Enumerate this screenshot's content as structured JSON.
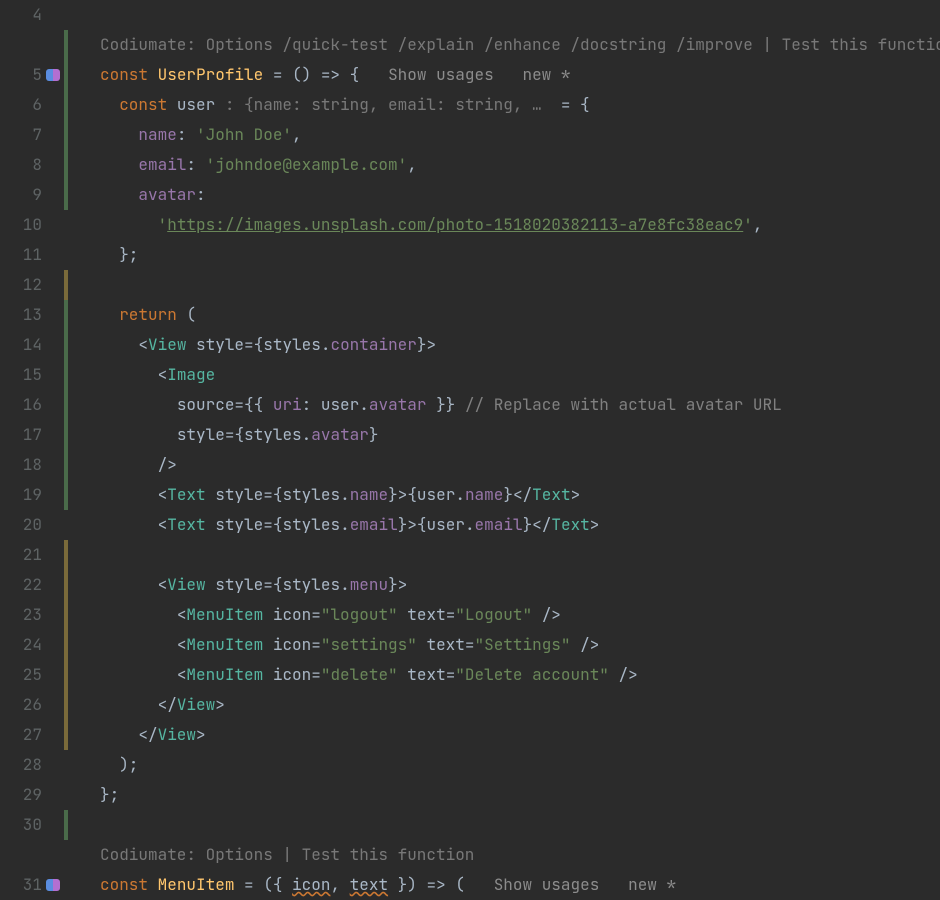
{
  "lineNumbers": [
    "4",
    "5",
    "6",
    "7",
    "8",
    "9",
    "10",
    "11",
    "12",
    "13",
    "14",
    "15",
    "16",
    "17",
    "18",
    "19",
    "20",
    "21",
    "22",
    "23",
    "24",
    "25",
    "26",
    "27",
    "28",
    "29",
    "30",
    "31"
  ],
  "iconLines": [
    1,
    27
  ],
  "bars": [
    {
      "from": 1,
      "to": 7,
      "cls": ""
    },
    {
      "from": 9,
      "to": 10,
      "cls": "yellow"
    },
    {
      "from": 10,
      "to": 17,
      "cls": ""
    },
    {
      "from": 18,
      "to": 25,
      "cls": "yellow"
    },
    {
      "from": 27,
      "to": 28,
      "cls": ""
    }
  ],
  "codiumate1": "Codiumate: Options /quick-test /explain /enhance /docstring /improve | Test this function",
  "l5": {
    "const": "const",
    "name": "UserProfile",
    "rest": " = () => {",
    "usages": "Show usages",
    "new": "new *"
  },
  "l6": {
    "const": "const",
    "name": "user",
    "hint": " : {name: string, email: string, … ",
    "rest": " = {"
  },
  "l7": {
    "prop": "name",
    "sep": ": ",
    "str": "'John Doe'",
    "end": ","
  },
  "l8": {
    "prop": "email",
    "sep": ": ",
    "str": "'johndoe@example.com'",
    "end": ","
  },
  "l9": {
    "prop": "avatar",
    "sep": ":"
  },
  "l10": {
    "q1": "'",
    "url": "https://images.unsplash.com/photo-1518020382113-a7e8fc38eac9",
    "q2": "'",
    "end": ","
  },
  "l11": {
    "end": "};"
  },
  "l13": {
    "ret": "return",
    "paren": " ("
  },
  "l14": {
    "open": "<",
    "tag": "View",
    "sp": " ",
    "attr": "style",
    "eq": "=",
    "lb": "{",
    "obj": "styles",
    "dot": ".",
    "p": "container",
    "rb": "}",
    "close": ">"
  },
  "l15": {
    "open": "<",
    "tag": "Image"
  },
  "l16": {
    "attr": "source",
    "eq": "=",
    "lb": "{{ ",
    "uri": "uri",
    "c": ": ",
    "obj": "user",
    "dot": ".",
    "p": "avatar",
    "rb": " }}",
    "cmt": " // Replace with actual avatar URL"
  },
  "l17": {
    "attr": "style",
    "eq": "=",
    "lb": "{",
    "obj": "styles",
    "dot": ".",
    "p": "avatar",
    "rb": "}"
  },
  "l18": {
    "close": "/>"
  },
  "l19": {
    "open": "<",
    "tag": "Text",
    "sp": " ",
    "attr": "style",
    "eq": "=",
    "lb": "{",
    "obj": "styles",
    "dot": ".",
    "p": "name",
    "rb": "}",
    "gt": ">",
    "elb": "{",
    "eo": "user",
    "ed": ".",
    "ep": "name",
    "erb": "}",
    "co": "</",
    "ct": "Text",
    "cg": ">"
  },
  "l20": {
    "open": "<",
    "tag": "Text",
    "sp": " ",
    "attr": "style",
    "eq": "=",
    "lb": "{",
    "obj": "styles",
    "dot": ".",
    "p": "email",
    "rb": "}",
    "gt": ">",
    "elb": "{",
    "eo": "user",
    "ed": ".",
    "ep": "email",
    "erb": "}",
    "co": "</",
    "ct": "Text",
    "cg": ">"
  },
  "l22": {
    "open": "<",
    "tag": "View",
    "sp": " ",
    "attr": "style",
    "eq": "=",
    "lb": "{",
    "obj": "styles",
    "dot": ".",
    "p": "menu",
    "rb": "}",
    "close": ">"
  },
  "l23": {
    "open": "<",
    "tag": "MenuItem",
    "sp": " ",
    "a1": "icon",
    "eq1": "=",
    "s1": "\"logout\"",
    "sp2": " ",
    "a2": "text",
    "eq2": "=",
    "s2": "\"Logout\"",
    "end": " />"
  },
  "l24": {
    "open": "<",
    "tag": "MenuItem",
    "sp": " ",
    "a1": "icon",
    "eq1": "=",
    "s1": "\"settings\"",
    "sp2": " ",
    "a2": "text",
    "eq2": "=",
    "s2": "\"Settings\"",
    "end": " />"
  },
  "l25": {
    "open": "<",
    "tag": "MenuItem",
    "sp": " ",
    "a1": "icon",
    "eq1": "=",
    "s1": "\"delete\"",
    "sp2": " ",
    "a2": "text",
    "eq2": "=",
    "s2": "\"Delete account\"",
    "end": " />"
  },
  "l26": {
    "co": "</",
    "tag": "View",
    "cg": ">"
  },
  "l27": {
    "co": "</",
    "tag": "View",
    "cg": ">"
  },
  "l28": {
    "end": ");"
  },
  "l29": {
    "end": "};"
  },
  "codiumate2": "Codiumate: Options | Test this function",
  "l31": {
    "const": "const",
    "name": "MenuItem",
    "rest1": " = ({ ",
    "p1": "icon",
    "c": ", ",
    "p2": "text",
    "rest2": " }) => (",
    "usages": "Show usages",
    "new": "new *"
  }
}
